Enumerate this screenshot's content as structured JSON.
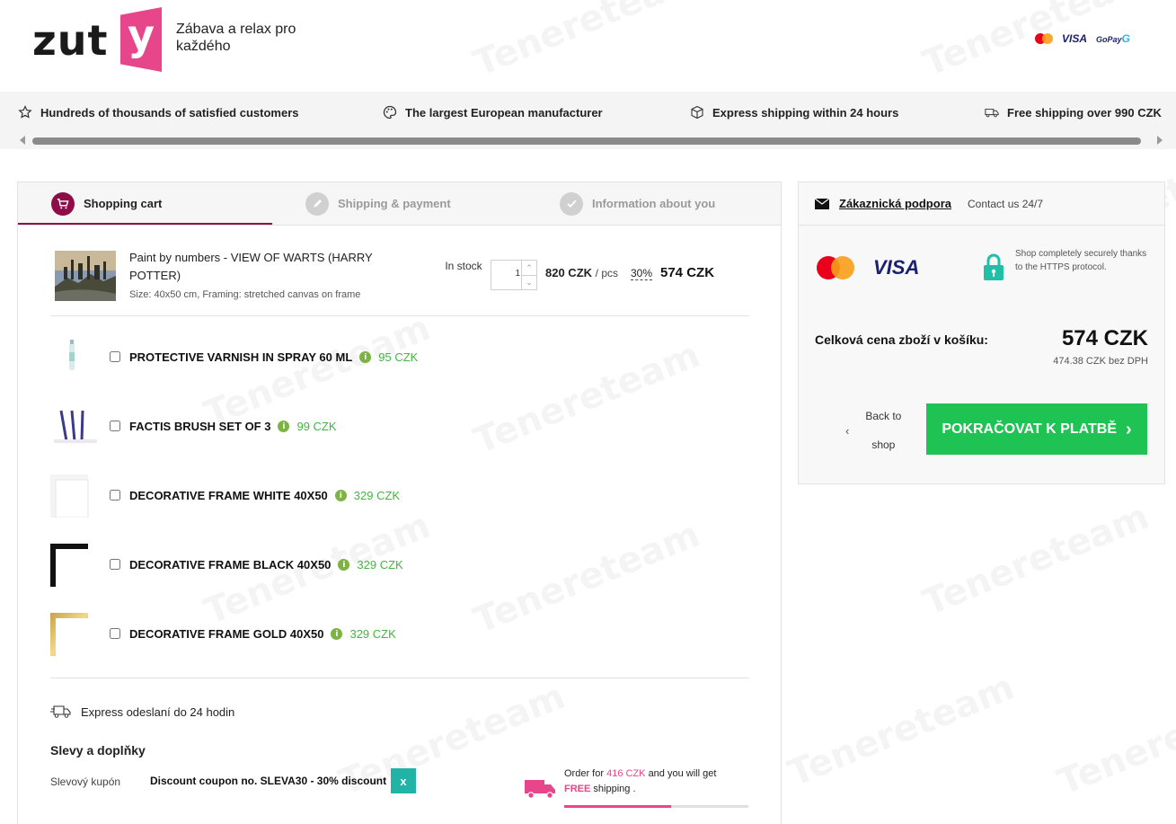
{
  "header": {
    "logo_text": "zut",
    "logo_y": "y",
    "tagline": "Zábava a relax pro každého",
    "payments": {
      "visa": "VISA",
      "gopay": "GoPay",
      "gopay_g": "G"
    }
  },
  "features": [
    {
      "icon": "star-icon",
      "label": "Hundreds of thousands of satisfied customers"
    },
    {
      "icon": "palette-icon",
      "label": "The largest European manufacturer"
    },
    {
      "icon": "box-icon",
      "label": "Express shipping within 24 hours"
    },
    {
      "icon": "truck-icon",
      "label": "Free shipping over 990 CZK"
    }
  ],
  "steps": [
    {
      "label": "Shopping cart",
      "active": true
    },
    {
      "label": "Shipping & payment",
      "active": false
    },
    {
      "label": "Information about you",
      "active": false
    }
  ],
  "cart_item": {
    "name": "Paint by numbers - VIEW OF WARTS (HARRY POTTER)",
    "meta": "Size: 40x50 cm, Framing: stretched canvas on frame",
    "stock": "In stock",
    "qty": "1",
    "unit_price": "820 CZK",
    "unit_suffix": "/ pcs",
    "discount": "30%",
    "total": "574 CZK"
  },
  "addons": [
    {
      "name": "PROTECTIVE VARNISH IN SPRAY 60 ML",
      "price": "95 CZK"
    },
    {
      "name": "FACTIS BRUSH SET OF 3",
      "price": "99 CZK"
    },
    {
      "name": "DECORATIVE FRAME WHITE 40X50",
      "price": "329 CZK"
    },
    {
      "name": "DECORATIVE FRAME BLACK 40X50",
      "price": "329 CZK"
    },
    {
      "name": "DECORATIVE FRAME GOLD 40X50",
      "price": "329 CZK"
    }
  ],
  "express": "Express odeslaní do 24 hodin",
  "discounts_title": "Slevy a doplňky",
  "coupon": {
    "label": "Slevový kupón",
    "value": "Discount coupon no. SLEVA30 - 30% discount",
    "remove": "x"
  },
  "free_shipping": {
    "prefix": "Order for",
    "amount": "416 CZK",
    "middle": "and you will get",
    "free": "FREE",
    "suffix": "shipping .",
    "progress": 0.58
  },
  "sidebar": {
    "support_link": "Zákaznická podpora",
    "support_sub": "Contact us 24/7",
    "visa": "VISA",
    "secure_text": "Shop completely securely thanks to the HTTPS protocol.",
    "total_label": "Celková cena zboží v košíku:",
    "total_value": "574 CZK",
    "total_sub": "474.38 CZK bez DPH",
    "back": "Back to shop",
    "cta": "POKRAČOVAT K PLATBĚ"
  },
  "watermark": "Tenereteam",
  "colors": {
    "brand": "#e8468a",
    "step_active": "#8e0d48",
    "cta": "#1ec353",
    "price_green": "#43b543",
    "coupon_btn": "#21b3a6"
  }
}
